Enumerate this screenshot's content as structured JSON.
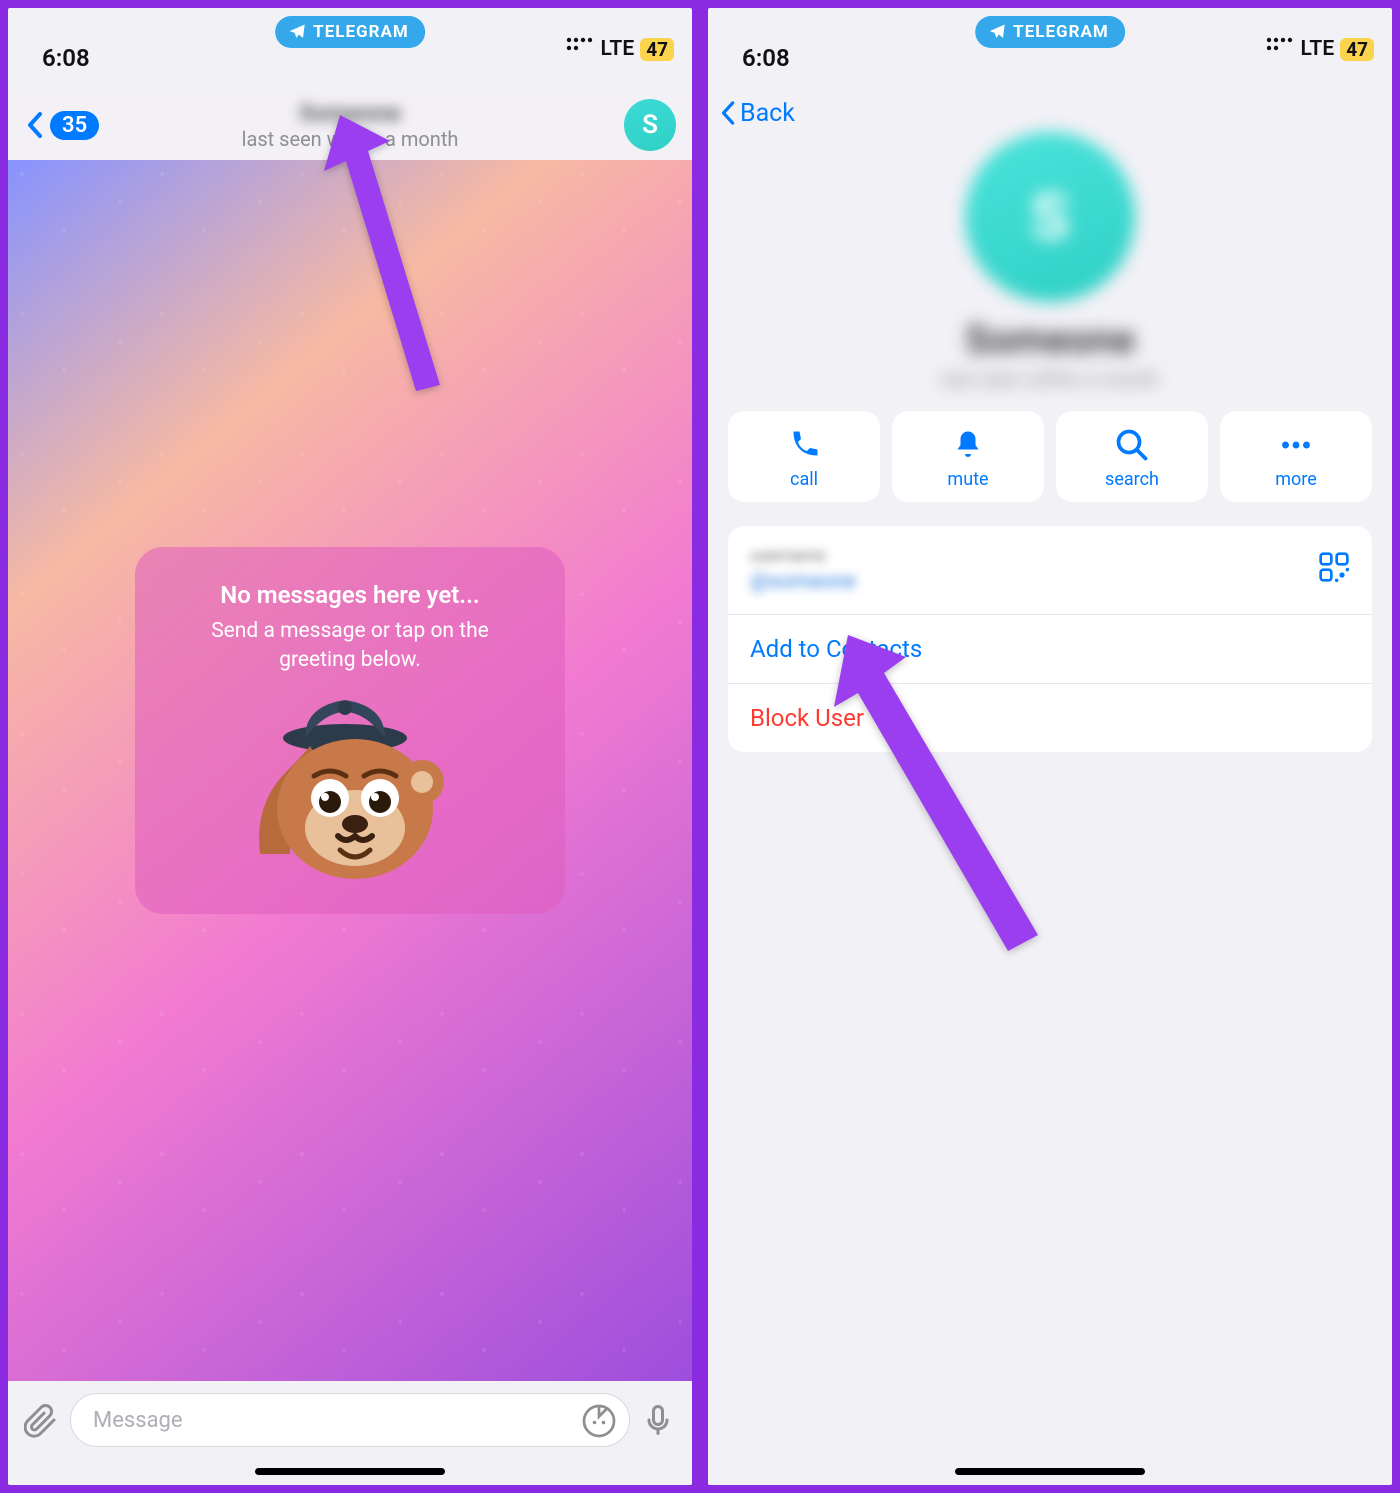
{
  "status": {
    "time": "6:08",
    "pill_label": "TELEGRAM",
    "network": "LTE",
    "battery": "47"
  },
  "left": {
    "back_count": "35",
    "contact_name": "Someone",
    "contact_status": "last seen within a month",
    "avatar_letter": "S",
    "greeting": {
      "title": "No messages here yet...",
      "subtitle": "Send a message or tap on the greeting below."
    },
    "input_placeholder": "Message"
  },
  "right": {
    "back_label": "Back",
    "profile_name": "Someone",
    "profile_status": "last seen within a month",
    "actions": {
      "call": "call",
      "mute": "mute",
      "search": "search",
      "more": "more"
    },
    "username_label": "username",
    "username_value": "@someone",
    "add_contacts": "Add to Contacts",
    "block_user": "Block User"
  }
}
